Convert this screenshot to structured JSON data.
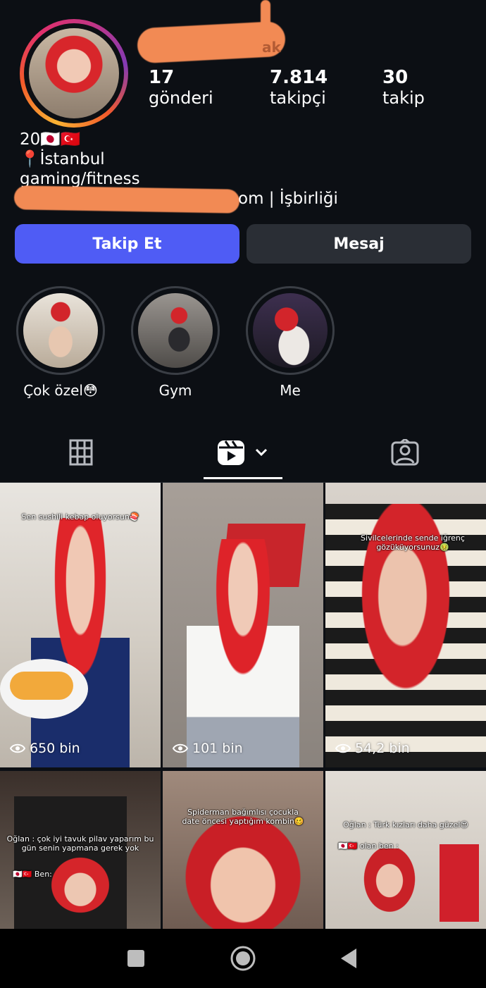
{
  "profile": {
    "username_visible_fragment": "ak",
    "stats": [
      {
        "value": "17",
        "label": "gönderi"
      },
      {
        "value": "7.814",
        "label": "takipçi"
      },
      {
        "value": "30",
        "label": "takip"
      }
    ],
    "bio": {
      "line1": "20🇯🇵🇹🇷",
      "line2": "📍İstanbul",
      "line3": "gaming/fitness",
      "link_suffix": "om | İşbirliği"
    }
  },
  "actions": {
    "follow_label": "Takip Et",
    "message_label": "Mesaj"
  },
  "highlights": [
    {
      "label": "Çok özel😳"
    },
    {
      "label": "Gym"
    },
    {
      "label": "Me"
    }
  ],
  "tabs": [
    {
      "icon": "grid-icon"
    },
    {
      "icon": "reels-icon",
      "active": true
    },
    {
      "icon": "tagged-icon"
    }
  ],
  "reels": [
    {
      "caption": "Sen sushili kebap oluyorsun🍣",
      "views": "650 bin"
    },
    {
      "caption": "",
      "views": "101 bin"
    },
    {
      "caption": "Sivilcelerinde sende iğrenç gözüküyorsunuz🤢",
      "views": "54,2 bin"
    },
    {
      "caption": "Oğlan : çok iyi tavuk pilav yaparım bu gün senin yapmana gerek yok",
      "caption2": "🇯🇵🇹🇷 Ben:",
      "views": ""
    },
    {
      "caption": "Spiderman bağımlısı çocukla date öncesi yaptığım kombin🥴",
      "views": ""
    },
    {
      "caption": "Oğlan : Türk kızları daha güzel😍",
      "caption2": "🇯🇵🇹🇷 olan ben :",
      "views": ""
    }
  ],
  "colors": {
    "background": "#0c0f14",
    "follow_button": "#4f5cf5",
    "message_button": "#2a2e35",
    "redaction": "#f28a54"
  }
}
